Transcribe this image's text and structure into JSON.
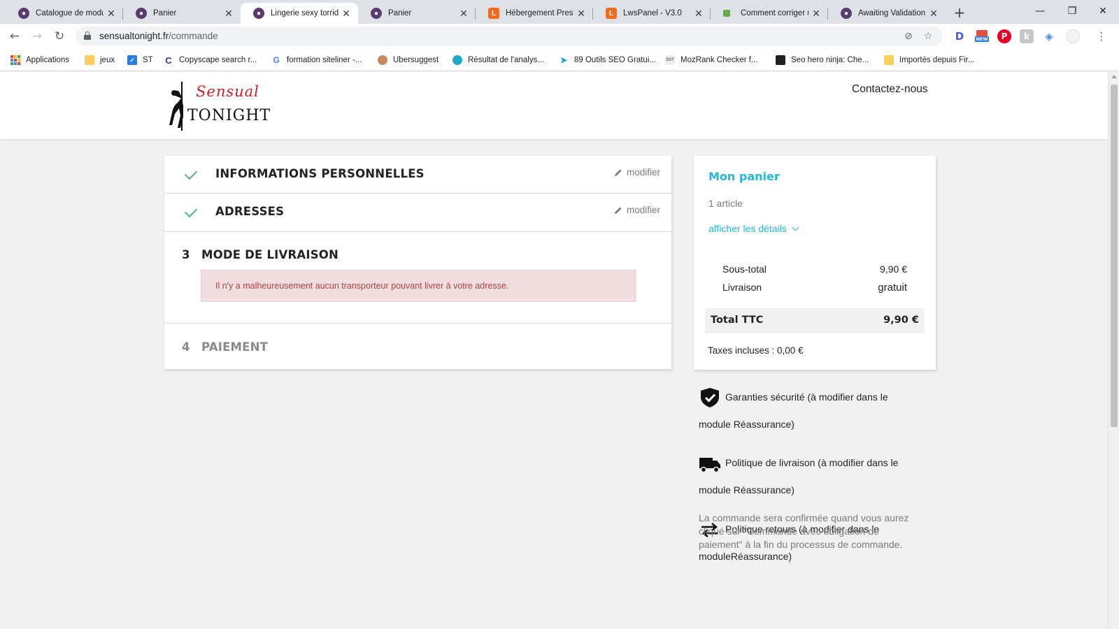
{
  "browser": {
    "tabs": [
      {
        "title": "Catalogue de modul",
        "icon": "prestashop-icon"
      },
      {
        "title": "Panier",
        "icon": "prestashop-icon"
      },
      {
        "title": "Lingerie sexy torride",
        "icon": "prestashop-icon",
        "active": true
      },
      {
        "title": "Panier",
        "icon": "prestashop-icon"
      },
      {
        "title": "Hébergement Presta",
        "icon": "lws-icon"
      },
      {
        "title": "LwsPanel - V3.0",
        "icon": "lws-icon"
      },
      {
        "title": "Comment corriger u",
        "icon": "puzzle-icon"
      },
      {
        "title": "Awaiting Validation",
        "icon": "prestashop-icon"
      }
    ],
    "url_host": "sensualtonight.fr",
    "url_path": "/commande",
    "bookmarks": [
      {
        "label": "Applications"
      },
      {
        "label": "jeux"
      },
      {
        "label": "ST"
      },
      {
        "label": "Copyscape search r..."
      },
      {
        "label": "formation siteliner -..."
      },
      {
        "label": "Ubersuggest"
      },
      {
        "label": "Résultat de l'analys..."
      },
      {
        "label": "89 Outils SEO Gratui..."
      },
      {
        "label": "MozRank Checker f..."
      },
      {
        "label": "Seo hero ninja: Che..."
      },
      {
        "label": "Importés depuis Fir..."
      }
    ],
    "extensions": {
      "d_label": "D",
      "new_label": "NEW"
    }
  },
  "site": {
    "logo_line1": "Sensual",
    "logo_line2": "TONIGHT",
    "contact_label": "Contactez-nous"
  },
  "checkout": {
    "steps": [
      {
        "number": "",
        "title": "INFORMATIONS PERSONNELLES",
        "status": "complete",
        "edit_label": "modifier"
      },
      {
        "number": "",
        "title": "ADRESSES",
        "status": "complete",
        "edit_label": "modifier"
      },
      {
        "number": "3",
        "title": "MODE DE LIVRAISON",
        "status": "current",
        "alert": "Il n'y a malheureusement aucun transporteur pouvant livrer à votre adresse."
      },
      {
        "number": "4",
        "title": "PAIEMENT",
        "status": "pending"
      }
    ]
  },
  "cart": {
    "title": "Mon panier",
    "count": "1 article",
    "details_label": "afficher les détails",
    "subtotal_label": "Sous-total",
    "subtotal_value": "9,90 €",
    "shipping_label": "Livraison",
    "shipping_value": "gratuit",
    "total_label": "Total TTC",
    "total_value": "9,90 €",
    "taxes_label": "Taxes incluses : 0,00 €"
  },
  "reassurance": [
    {
      "icon": "shield-check-icon",
      "text_line1": "Garanties sécurité (à modifier dans le",
      "text_line2": "module Réassurance)"
    },
    {
      "icon": "truck-icon",
      "text_line1": "Politique de livraison (à modifier dans le",
      "text_line2": "module Réassurance)"
    },
    {
      "icon": "swap-arrows-icon",
      "text_line1": "Politique retours (à modifier dans le",
      "text_line2": "moduleRéassurance)"
    }
  ],
  "confirm_note_line1": "La commande sera confirmée quand vous aurez",
  "confirm_note_line2": "cliqué sur \"Commande avec obligation de",
  "confirm_note_line3": "paiement\" à la fin du processus de commande.",
  "colors": {
    "accent": "#24b9d7",
    "check": "#4cbb6c",
    "alert_bg": "#f2dede",
    "alert_text": "#a94442",
    "brand_red": "#c9212b"
  }
}
